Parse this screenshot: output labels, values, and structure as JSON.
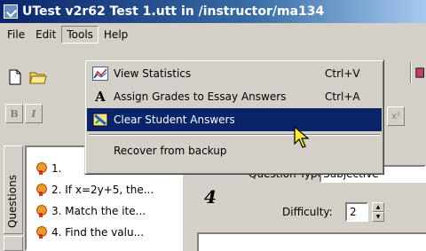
{
  "window": {
    "title": "UTest v2r62 Test 1.utt in /instructor/ma134"
  },
  "menubar": {
    "items": [
      "File",
      "Edit",
      "Tools",
      "Help"
    ]
  },
  "toolbar": {
    "bold": "B",
    "italic": "I",
    "right_stub": "x²"
  },
  "tools_menu": {
    "items": [
      {
        "label": "View Statistics",
        "shortcut": "Ctrl+V",
        "icon": "chart-icon"
      },
      {
        "label": "Assign Grades to Essay Answers",
        "shortcut": "Ctrl+A",
        "icon": "grade-icon"
      },
      {
        "label": "Clear Student Answers",
        "shortcut": "",
        "icon": "clear-icon",
        "selected": true
      },
      {
        "label": "Recover from backup",
        "shortcut": "",
        "icon": ""
      }
    ]
  },
  "sidebar": {
    "tab_label": "Questions",
    "questions": [
      "1.",
      "2. If x=2y+5, the...",
      "3. Match the ite...",
      "4. Find the valu..."
    ]
  },
  "question_pane": {
    "number": "4",
    "type_label": "Question Type:",
    "type_value": "Subjective",
    "difficulty_label": "Difficulty:",
    "difficulty_value": "2"
  },
  "colors": {
    "title_bar": "#0a246a",
    "selection": "#0a246a",
    "window_bg": "#d4d0c8"
  }
}
